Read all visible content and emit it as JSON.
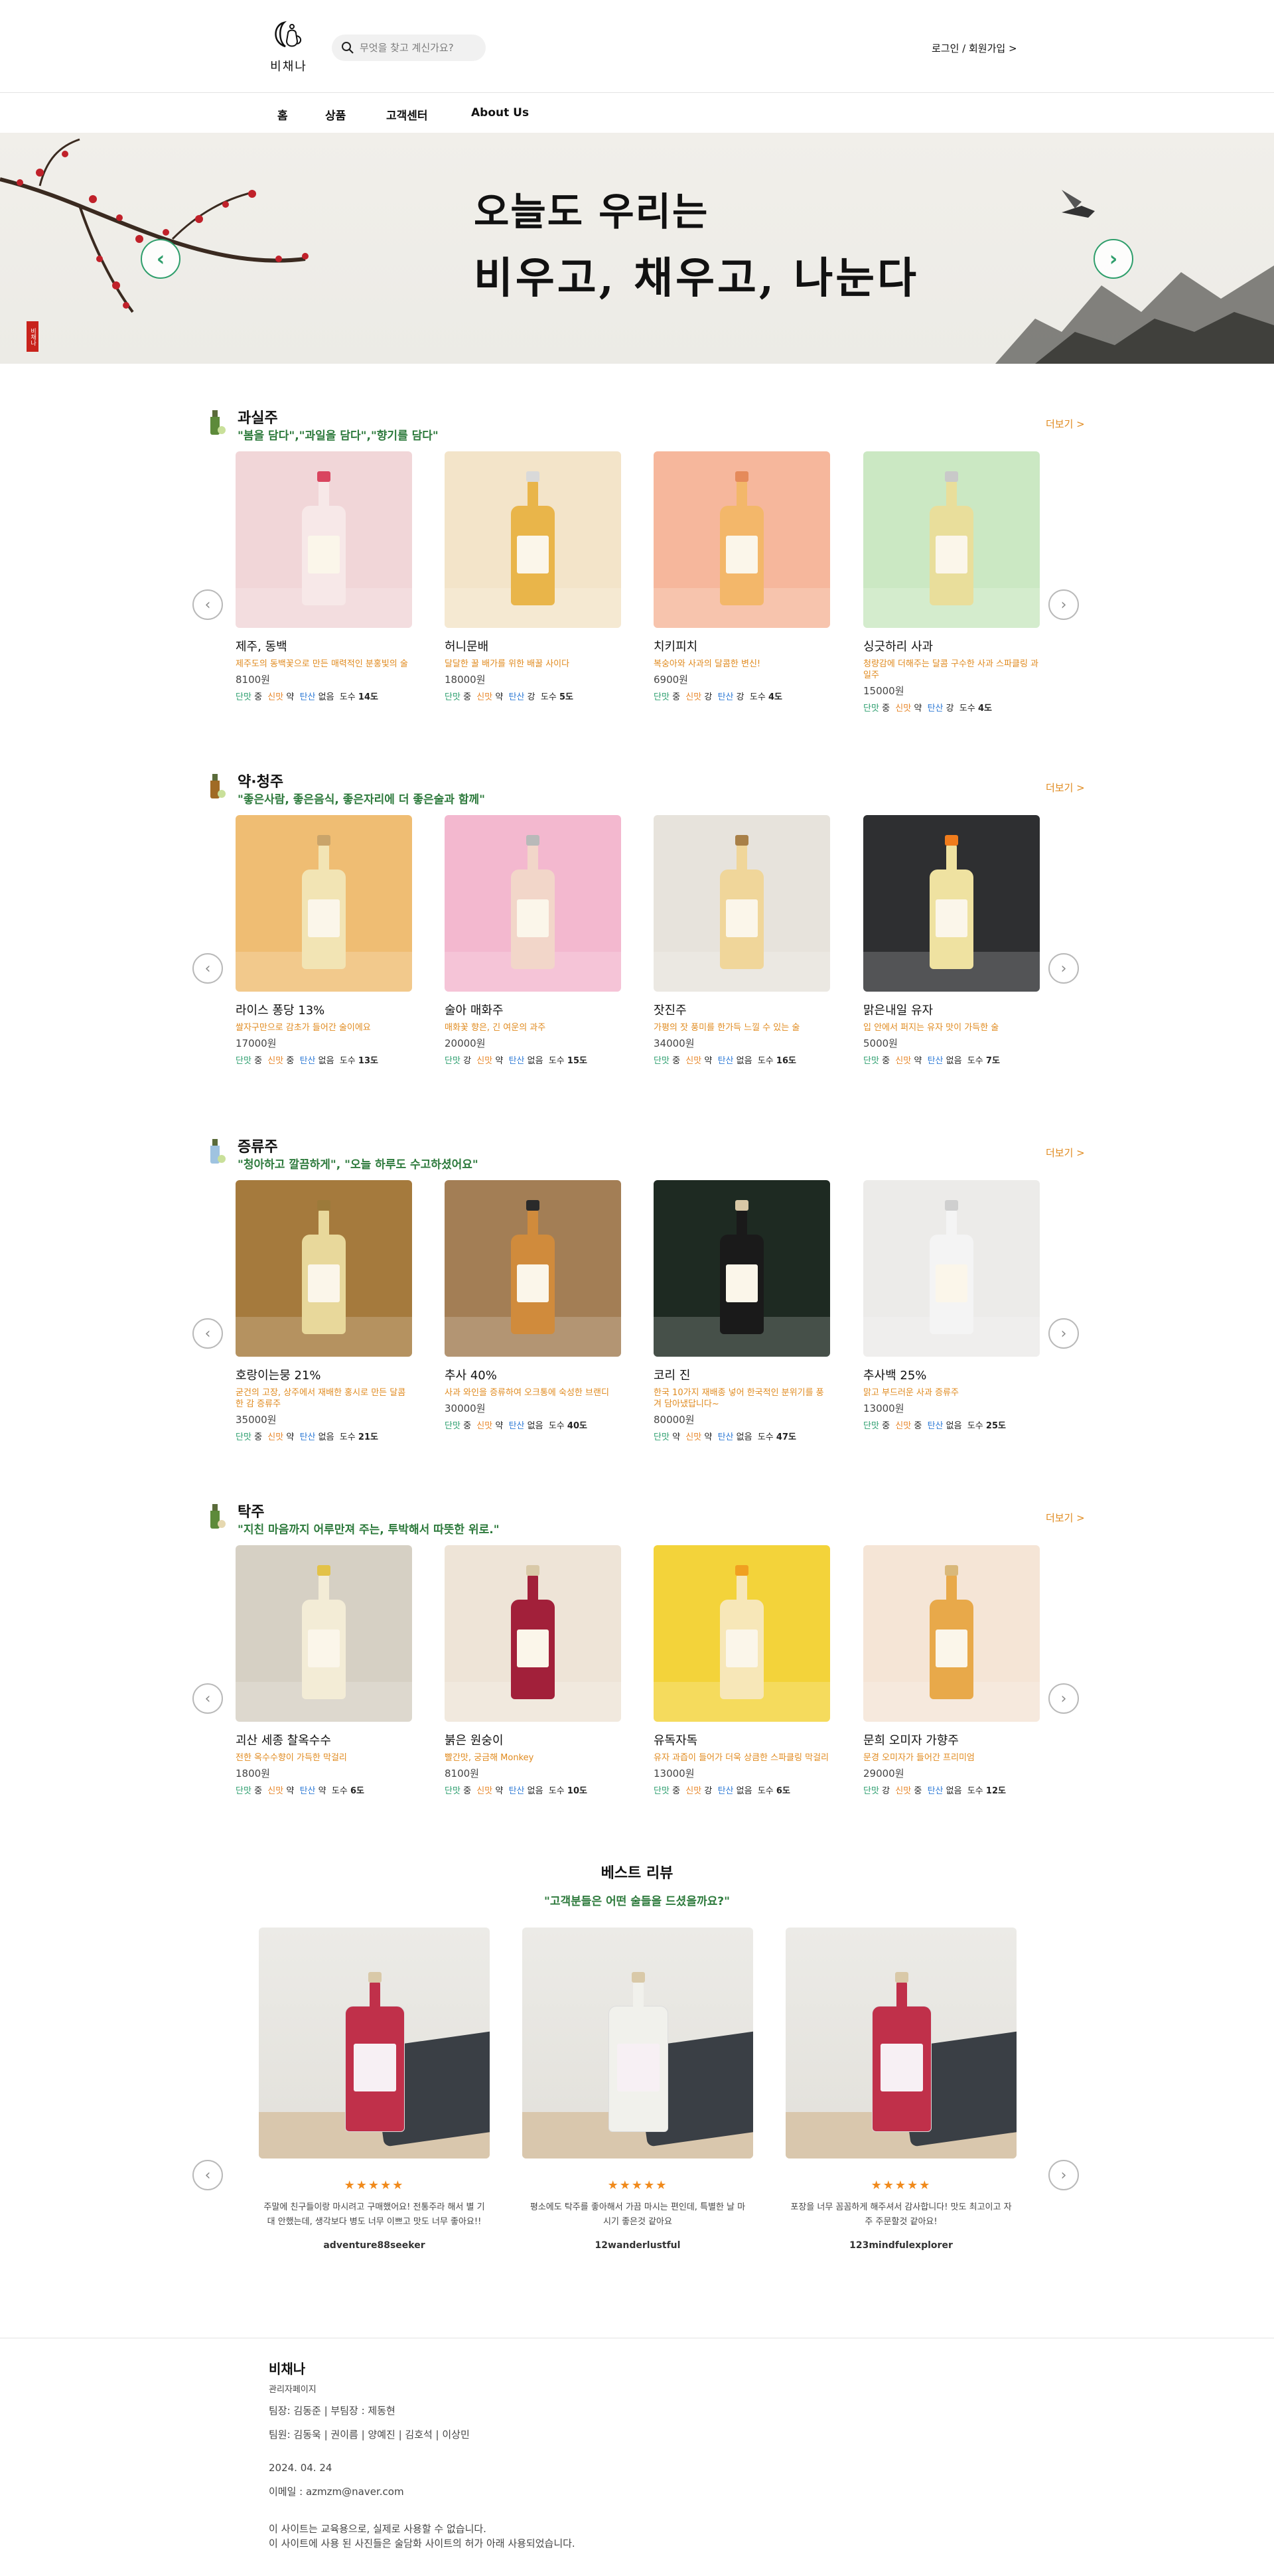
{
  "header": {
    "logo_text": "비채나",
    "search_placeholder": "무엇을 찾고 계신가요?",
    "login_label": "로그인 / 회원가입 >"
  },
  "nav": {
    "items": [
      {
        "label": "홈"
      },
      {
        "label": "상품"
      },
      {
        "label": "고객센터"
      },
      {
        "label": "About Us"
      }
    ]
  },
  "banner": {
    "line1": "오늘도 우리는",
    "line2": "비우고, 채우고, 나눈다",
    "stamp": "비채나"
  },
  "sections": [
    {
      "title": "과실주",
      "subtitle": "\"봄을 담다\",\"과일을 담다\",\"향기를 담다\"",
      "more": "더보기 >",
      "products": [
        {
          "name": "제주, 동백",
          "desc": "제주도의 동백꽃으로 만든 매력적인 분홍빛의 술",
          "price": "8100원",
          "sweet": "중",
          "sour": "약",
          "carb": "없음",
          "abv": "14도",
          "bg": "#f1d6d8",
          "bottle": "#f7e8e8",
          "cap": "#d9455f"
        },
        {
          "name": "허니문배",
          "desc": "달달한 꿀 배가를 위한 배꿀 사이다",
          "price": "18000원",
          "sweet": "중",
          "sour": "약",
          "carb": "강",
          "abv": "5도",
          "bg": "#f3e4c9",
          "bottle": "#e9b54a",
          "cap": "#d9d9d9"
        },
        {
          "name": "치키피치",
          "desc": "복숭아와 사과의 달콤한 변신!",
          "price": "6900원",
          "sweet": "중",
          "sour": "강",
          "carb": "강",
          "abv": "4도",
          "bg": "#f6b79c",
          "bottle": "#f3b76a",
          "cap": "#e58a5a"
        },
        {
          "name": "싱긋하리 사과",
          "desc": "청량감에 더해주는 달콤 구수한 사과 스파클링 과일주",
          "price": "15000원",
          "sweet": "중",
          "sour": "약",
          "carb": "강",
          "abv": "4도",
          "bg": "#cbe8c3",
          "bottle": "#e9de9b",
          "cap": "#c9c9c9"
        }
      ]
    },
    {
      "title": "약·청주",
      "subtitle": "\"좋은사람, 좋은음식, 좋은자리에 더 좋은술과 함께\"",
      "more": "더보기 >",
      "products": [
        {
          "name": "라이스 퐁당 13%",
          "desc": "쌀자구만으로 감초가 들어간 술이에요",
          "price": "17000원",
          "sweet": "중",
          "sour": "중",
          "carb": "없음",
          "abv": "13도",
          "bg": "#efbd73",
          "bottle": "#f2e4b4",
          "cap": "#c9a46a"
        },
        {
          "name": "술아 매화주",
          "desc": "매화꽃 향은, 긴 여운의 과주",
          "price": "20000원",
          "sweet": "강",
          "sour": "약",
          "carb": "없음",
          "abv": "15도",
          "bg": "#f3b8cf",
          "bottle": "#f2d6c9",
          "cap": "#b9b9b9"
        },
        {
          "name": "잣진주",
          "desc": "가평의 잣 풍미를 한가득 느낄 수 있는 술",
          "price": "34000원",
          "sweet": "중",
          "sour": "약",
          "carb": "없음",
          "abv": "16도",
          "bg": "#e7e3dc",
          "bottle": "#f0d69a",
          "cap": "#a88048"
        },
        {
          "name": "맑은내일 유자",
          "desc": "입 안에서 퍼지는 유자 맛이 가득한 술",
          "price": "5000원",
          "sweet": "중",
          "sour": "약",
          "carb": "없음",
          "abv": "7도",
          "bg": "#2e2f31",
          "bottle": "#efe2a1",
          "cap": "#f07c1c"
        }
      ]
    },
    {
      "title": "증류주",
      "subtitle": "\"청아하고 깔끔하게\", \"오늘 하루도 수고하셨어요\"",
      "more": "더보기 >",
      "products": [
        {
          "name": "호랑이는뭉 21%",
          "desc": "굳건의 고장, 상주에서 재배한 홍시로 만든 달콤한 감 증류주",
          "price": "35000원",
          "sweet": "중",
          "sour": "약",
          "carb": "없음",
          "abv": "21도",
          "bg": "#a57a3d",
          "bottle": "#e8d89b",
          "cap": "#9c7a3a"
        },
        {
          "name": "추사 40%",
          "desc": "사과 와인을 증류하여 오크통에 숙성한 브랜디",
          "price": "30000원",
          "sweet": "중",
          "sour": "약",
          "carb": "없음",
          "abv": "40도",
          "bg": "#a37e55",
          "bottle": "#d08b3c",
          "cap": "#2a2a2a"
        },
        {
          "name": "코리 진",
          "desc": "한국 10가지 재배종 넣어 한국적인 분위기를 풍겨 담아냈답니다~",
          "price": "80000원",
          "sweet": "약",
          "sour": "약",
          "carb": "없음",
          "abv": "47도",
          "bg": "#1e2a22",
          "bottle": "#1a1a1a",
          "cap": "#d8c8a6"
        },
        {
          "name": "추사백 25%",
          "desc": "맑고 부드러운 사과 증류주",
          "price": "13000원",
          "sweet": "중",
          "sour": "중",
          "carb": "없음",
          "abv": "25도",
          "bg": "#ecebe9",
          "bottle": "#f4f4f4",
          "cap": "#cfcfcf"
        }
      ]
    },
    {
      "title": "탁주",
      "subtitle": "\"지친 마음까지 어루만져 주는, 투박해서 따뜻한 위로.\"",
      "more": "더보기 >",
      "products": [
        {
          "name": "괴산 세종 찰옥수수",
          "desc": "전한 옥수수향이 가득한 막걸리",
          "price": "1800원",
          "sweet": "중",
          "sour": "약",
          "carb": "약",
          "abv": "6도",
          "bg": "#d6d0c4",
          "bottle": "#f3ecd6",
          "cap": "#e3c248"
        },
        {
          "name": "붉은 원숭이",
          "desc": "빨간맛, 궁금해 Monkey",
          "price": "8100원",
          "sweet": "중",
          "sour": "약",
          "carb": "없음",
          "abv": "10도",
          "bg": "#eee4d7",
          "bottle": "#a2203a",
          "cap": "#d9c9a8"
        },
        {
          "name": "유독자독",
          "desc": "유자 과즙이 들어가 더욱 상큼한 스파클링 막걸리",
          "price": "13000원",
          "sweet": "중",
          "sour": "강",
          "carb": "없음",
          "abv": "6도",
          "bg": "#f3d33a",
          "bottle": "#f7e7b8",
          "cap": "#f0a020"
        },
        {
          "name": "문희 오미자 가향주",
          "desc": "문경 오미자가 들어간 프리미엄",
          "price": "29000원",
          "sweet": "강",
          "sour": "중",
          "carb": "없음",
          "abv": "12도",
          "bg": "#f5e5d6",
          "bottle": "#e8a94a",
          "cap": "#d9b87a"
        }
      ]
    }
  ],
  "review": {
    "title": "베스트 리뷰",
    "subtitle": "\"고객분들은 어떤 술들을 드셨을까요?\"",
    "items": [
      {
        "stars": "★★★★★",
        "text": "주말에 친구들이랑 마시려고 구매했어요! 전통주라 해서 별 기대 안했는데, 생각보다 병도 너무 이쁘고 맛도 너무 좋아요!!",
        "user": "adventure88seeker",
        "bottle": "#c0304a"
      },
      {
        "stars": "★★★★★",
        "text": "평소에도 탁주를 좋아해서 가끔 마시는 편인데, 특별한 날 마시기 좋은것 같아요",
        "user": "12wanderlustful",
        "bottle": "#f1f1ec"
      },
      {
        "stars": "★★★★★",
        "text": "포장을 너무 꼼꼼하게 해주셔서 감사합니다! 맛도 최고이고 자주 주문할것 같아요!",
        "user": "123mindfulexplorer",
        "bottle": "#c0304a"
      }
    ]
  },
  "footer": {
    "brand": "비채나",
    "admin": "관리자페이지",
    "leaders": "팀장: 김동준 | 부팀장 : 제동현",
    "members": "팀원: 김동욱 | 권이름 | 양예진 | 김호석 | 이상민",
    "date": "2024. 04. 24",
    "email": "이메일 : azmzm@naver.com",
    "notice1": "이 사이트는 교육용으로, 실제로 사용할 수 없습니다.",
    "notice2": "이 사이트에 사용 된 사진들은 술담화 사이트의 허가 아래 사용되었습니다."
  },
  "colors": {
    "accent_green": "#2d7a3c",
    "accent_orange": "#e08a1e",
    "sweet": "#2b9e6e",
    "sour": "#e8872a",
    "carb": "#2f7bd6"
  },
  "labels": {
    "sweet": "단맛",
    "sour": "신맛",
    "carb": "탄산",
    "abv": "도수"
  }
}
